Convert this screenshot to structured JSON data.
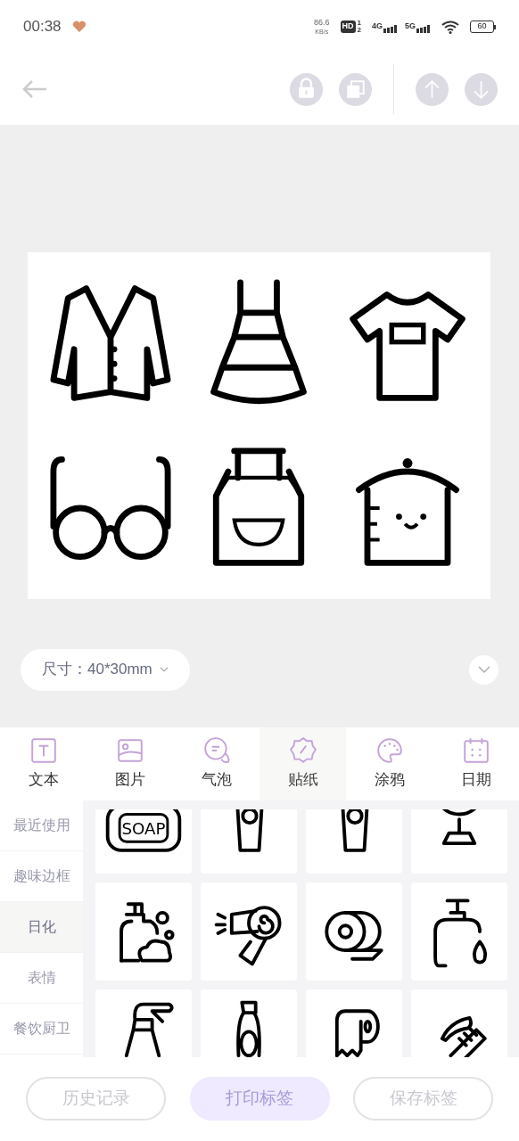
{
  "status_bar": {
    "time": "00:38",
    "net_speed": "86.6",
    "net_unit": "KB/s",
    "hd": "HD",
    "sims": [
      "1",
      "2"
    ],
    "networks": [
      "4G",
      "5G"
    ],
    "battery": "60"
  },
  "toolbar": {
    "buttons": [
      {
        "kind": "lock"
      },
      {
        "kind": "copy"
      },
      {
        "kind": "up"
      },
      {
        "kind": "down"
      }
    ]
  },
  "label": {
    "stickers": [
      {
        "kind": "jacket"
      },
      {
        "kind": "dress"
      },
      {
        "kind": "tshirt"
      },
      {
        "kind": "glasses"
      },
      {
        "kind": "apron"
      },
      {
        "kind": "jar"
      }
    ]
  },
  "size_selector": "尺寸：40*30mm",
  "tabs": [
    {
      "label": "文本",
      "kind": "text",
      "selected": false
    },
    {
      "label": "图片",
      "kind": "image",
      "selected": false
    },
    {
      "label": "气泡",
      "kind": "bubble",
      "selected": false
    },
    {
      "label": "贴纸",
      "kind": "sticker",
      "selected": true
    },
    {
      "label": "涂鸦",
      "kind": "palette",
      "selected": false
    },
    {
      "label": "日期",
      "kind": "calendar",
      "selected": false
    }
  ],
  "categories": [
    {
      "label": "最近使用",
      "selected": false
    },
    {
      "label": "趣味边框",
      "selected": false
    },
    {
      "label": "日化",
      "selected": true
    },
    {
      "label": "表情",
      "selected": false
    },
    {
      "label": "餐饮厨卫",
      "selected": false
    }
  ],
  "stickers": [
    {
      "kind": "soap",
      "text": "SOAP"
    },
    {
      "kind": "tube"
    },
    {
      "kind": "tube"
    },
    {
      "kind": "mirror"
    },
    {
      "kind": "dispenser"
    },
    {
      "kind": "dryer"
    },
    {
      "kind": "tape"
    },
    {
      "kind": "lotion"
    },
    {
      "kind": "spray"
    },
    {
      "kind": "bottle"
    },
    {
      "kind": "toilet_paper"
    },
    {
      "kind": "comb"
    }
  ],
  "buttons": [
    {
      "label": "历史记录",
      "kind": "outline"
    },
    {
      "label": "打印标签",
      "kind": "primary"
    },
    {
      "label": "保存标签",
      "kind": "outline"
    }
  ]
}
